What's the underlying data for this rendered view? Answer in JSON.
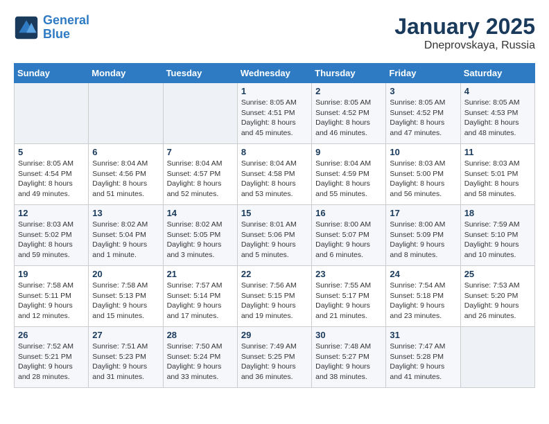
{
  "logo": {
    "name_line1": "General",
    "name_line2": "Blue"
  },
  "title": "January 2025",
  "subtitle": "Dneprovskaya, Russia",
  "weekdays": [
    "Sunday",
    "Monday",
    "Tuesday",
    "Wednesday",
    "Thursday",
    "Friday",
    "Saturday"
  ],
  "weeks": [
    [
      {
        "day": "",
        "info": ""
      },
      {
        "day": "",
        "info": ""
      },
      {
        "day": "",
        "info": ""
      },
      {
        "day": "1",
        "info": "Sunrise: 8:05 AM\nSunset: 4:51 PM\nDaylight: 8 hours\nand 45 minutes."
      },
      {
        "day": "2",
        "info": "Sunrise: 8:05 AM\nSunset: 4:52 PM\nDaylight: 8 hours\nand 46 minutes."
      },
      {
        "day": "3",
        "info": "Sunrise: 8:05 AM\nSunset: 4:52 PM\nDaylight: 8 hours\nand 47 minutes."
      },
      {
        "day": "4",
        "info": "Sunrise: 8:05 AM\nSunset: 4:53 PM\nDaylight: 8 hours\nand 48 minutes."
      }
    ],
    [
      {
        "day": "5",
        "info": "Sunrise: 8:05 AM\nSunset: 4:54 PM\nDaylight: 8 hours\nand 49 minutes."
      },
      {
        "day": "6",
        "info": "Sunrise: 8:04 AM\nSunset: 4:56 PM\nDaylight: 8 hours\nand 51 minutes."
      },
      {
        "day": "7",
        "info": "Sunrise: 8:04 AM\nSunset: 4:57 PM\nDaylight: 8 hours\nand 52 minutes."
      },
      {
        "day": "8",
        "info": "Sunrise: 8:04 AM\nSunset: 4:58 PM\nDaylight: 8 hours\nand 53 minutes."
      },
      {
        "day": "9",
        "info": "Sunrise: 8:04 AM\nSunset: 4:59 PM\nDaylight: 8 hours\nand 55 minutes."
      },
      {
        "day": "10",
        "info": "Sunrise: 8:03 AM\nSunset: 5:00 PM\nDaylight: 8 hours\nand 56 minutes."
      },
      {
        "day": "11",
        "info": "Sunrise: 8:03 AM\nSunset: 5:01 PM\nDaylight: 8 hours\nand 58 minutes."
      }
    ],
    [
      {
        "day": "12",
        "info": "Sunrise: 8:03 AM\nSunset: 5:02 PM\nDaylight: 8 hours\nand 59 minutes."
      },
      {
        "day": "13",
        "info": "Sunrise: 8:02 AM\nSunset: 5:04 PM\nDaylight: 9 hours\nand 1 minute."
      },
      {
        "day": "14",
        "info": "Sunrise: 8:02 AM\nSunset: 5:05 PM\nDaylight: 9 hours\nand 3 minutes."
      },
      {
        "day": "15",
        "info": "Sunrise: 8:01 AM\nSunset: 5:06 PM\nDaylight: 9 hours\nand 5 minutes."
      },
      {
        "day": "16",
        "info": "Sunrise: 8:00 AM\nSunset: 5:07 PM\nDaylight: 9 hours\nand 6 minutes."
      },
      {
        "day": "17",
        "info": "Sunrise: 8:00 AM\nSunset: 5:09 PM\nDaylight: 9 hours\nand 8 minutes."
      },
      {
        "day": "18",
        "info": "Sunrise: 7:59 AM\nSunset: 5:10 PM\nDaylight: 9 hours\nand 10 minutes."
      }
    ],
    [
      {
        "day": "19",
        "info": "Sunrise: 7:58 AM\nSunset: 5:11 PM\nDaylight: 9 hours\nand 12 minutes."
      },
      {
        "day": "20",
        "info": "Sunrise: 7:58 AM\nSunset: 5:13 PM\nDaylight: 9 hours\nand 15 minutes."
      },
      {
        "day": "21",
        "info": "Sunrise: 7:57 AM\nSunset: 5:14 PM\nDaylight: 9 hours\nand 17 minutes."
      },
      {
        "day": "22",
        "info": "Sunrise: 7:56 AM\nSunset: 5:15 PM\nDaylight: 9 hours\nand 19 minutes."
      },
      {
        "day": "23",
        "info": "Sunrise: 7:55 AM\nSunset: 5:17 PM\nDaylight: 9 hours\nand 21 minutes."
      },
      {
        "day": "24",
        "info": "Sunrise: 7:54 AM\nSunset: 5:18 PM\nDaylight: 9 hours\nand 23 minutes."
      },
      {
        "day": "25",
        "info": "Sunrise: 7:53 AM\nSunset: 5:20 PM\nDaylight: 9 hours\nand 26 minutes."
      }
    ],
    [
      {
        "day": "26",
        "info": "Sunrise: 7:52 AM\nSunset: 5:21 PM\nDaylight: 9 hours\nand 28 minutes."
      },
      {
        "day": "27",
        "info": "Sunrise: 7:51 AM\nSunset: 5:23 PM\nDaylight: 9 hours\nand 31 minutes."
      },
      {
        "day": "28",
        "info": "Sunrise: 7:50 AM\nSunset: 5:24 PM\nDaylight: 9 hours\nand 33 minutes."
      },
      {
        "day": "29",
        "info": "Sunrise: 7:49 AM\nSunset: 5:25 PM\nDaylight: 9 hours\nand 36 minutes."
      },
      {
        "day": "30",
        "info": "Sunrise: 7:48 AM\nSunset: 5:27 PM\nDaylight: 9 hours\nand 38 minutes."
      },
      {
        "day": "31",
        "info": "Sunrise: 7:47 AM\nSunset: 5:28 PM\nDaylight: 9 hours\nand 41 minutes."
      },
      {
        "day": "",
        "info": ""
      }
    ]
  ]
}
